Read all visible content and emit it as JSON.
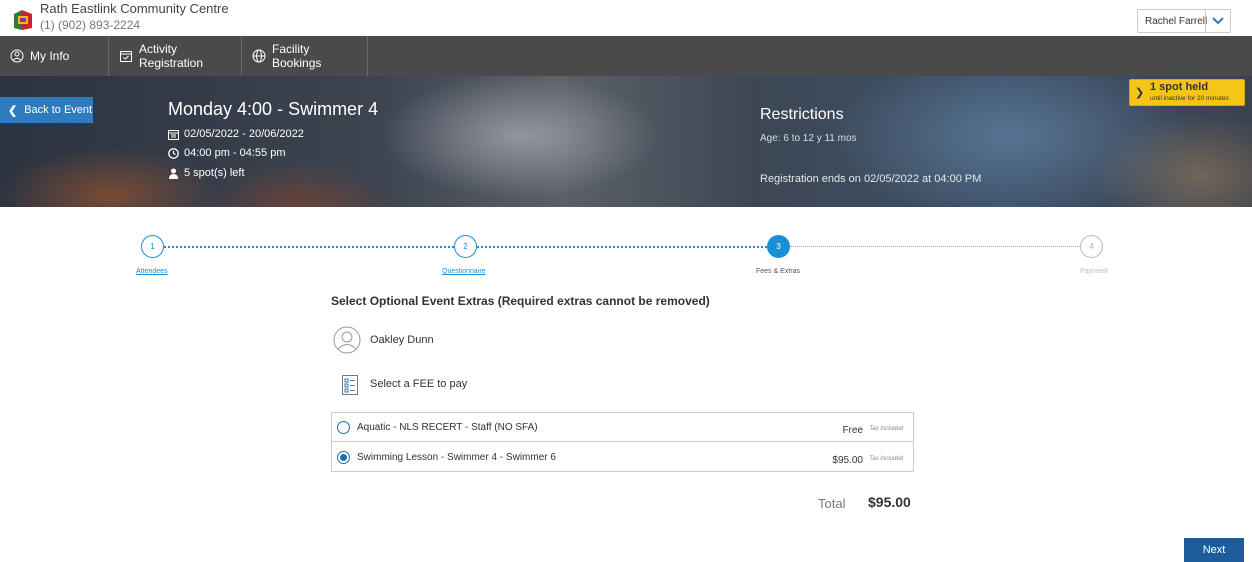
{
  "header": {
    "org_name": "Rath Eastlink Community Centre",
    "org_phone": "(1) (902) 893-2224",
    "user_name": "Rachel Farrell"
  },
  "nav": {
    "items": [
      {
        "label": "My Info",
        "icon": "user-circle-icon"
      },
      {
        "label": "Activity Registration",
        "icon": "calendar-check-icon"
      },
      {
        "label": "Facility Bookings",
        "icon": "globe-icon"
      }
    ]
  },
  "event": {
    "back_label": "Back to Event",
    "title": "Monday 4:00 - Swimmer 4",
    "dates": "02/05/2022 - 20/06/2022",
    "time": "04:00 pm - 04:55 pm",
    "spots": "5 spot(s) left"
  },
  "restrictions": {
    "title": "Restrictions",
    "age": "Age: 6 to 12 y 11 mos",
    "ends": "Registration ends on 02/05/2022 at 04:00 PM"
  },
  "spot_held": {
    "title": "1 spot held",
    "subtitle": "until inactive for 20 minutes"
  },
  "steps": [
    {
      "num": "1",
      "label": "Attendees",
      "state": "done"
    },
    {
      "num": "2",
      "label": "Questionnaire",
      "state": "done"
    },
    {
      "num": "3",
      "label": "Fees & Extras",
      "state": "active"
    },
    {
      "num": "4",
      "label": "Payment",
      "state": "todo"
    }
  ],
  "content": {
    "section_title": "Select Optional Event Extras (Required extras cannot be removed)",
    "person_name": "Oakley Dunn",
    "fee_prompt": "Select a FEE to pay",
    "fees": [
      {
        "name": "Aquatic - NLS RECERT - Staff (NO SFA)",
        "price": "Free",
        "tax": "Tax Included",
        "selected": false
      },
      {
        "name": "Swimming Lesson - Swimmer 4 - Swimmer 6",
        "price": "$95.00",
        "tax": "Tax Included",
        "selected": true
      }
    ],
    "total_label": "Total",
    "total_value": "$95.00",
    "next_label": "Next"
  },
  "colors": {
    "accent": "#1a8fd6",
    "nav_bg": "#4a4a4a",
    "back_btn": "#2e7bbf",
    "next_btn": "#1e5d9c",
    "spot_held": "#f5c518"
  }
}
